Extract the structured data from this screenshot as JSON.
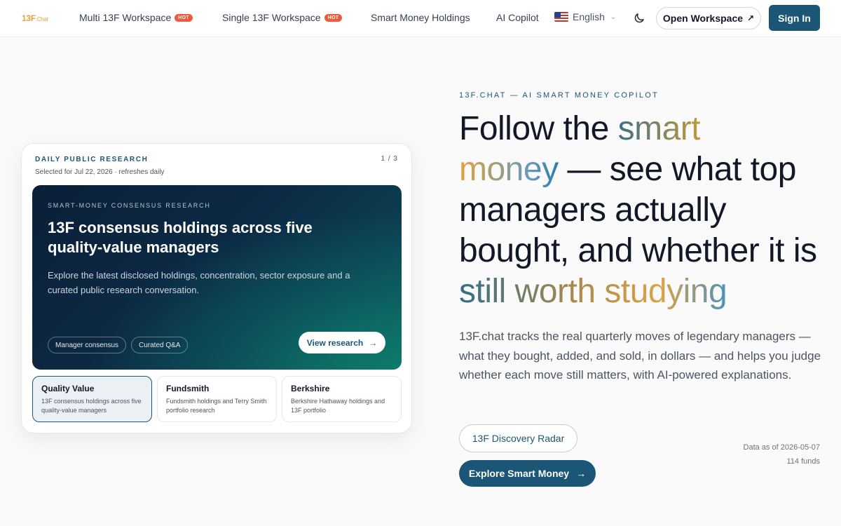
{
  "nav": {
    "logo": "13F",
    "logo_suffix": ".Chat",
    "links": [
      {
        "label": "Multi 13F Workspace",
        "badge": "HOT"
      },
      {
        "label": "Single 13F Workspace",
        "badge": "HOT"
      },
      {
        "label": "Smart Money Holdings"
      },
      {
        "label": "AI Copilot"
      }
    ],
    "language": "English",
    "open_workspace": "Open Workspace",
    "sign_in": "Sign In"
  },
  "card": {
    "eyebrow": "DAILY PUBLIC RESEARCH",
    "subtitle": "Selected for Jul 22, 2026 · refreshes daily",
    "counter": "1 / 3",
    "hero": {
      "eyebrow": "SMART-MONEY CONSENSUS RESEARCH",
      "title": "13F consensus holdings across five quality-value managers",
      "description": "Explore the latest disclosed holdings, concentration, sector exposure and a curated public research conversation.",
      "tags": [
        "Manager consensus",
        "Curated Q&A"
      ],
      "cta": "View research"
    },
    "tabs": [
      {
        "title": "Quality Value",
        "desc": "13F consensus holdings across five quality-value managers"
      },
      {
        "title": "Fundsmith",
        "desc": "Fundsmith holdings and Terry Smith portfolio research"
      },
      {
        "title": "Berkshire",
        "desc": "Berkshire Hathaway holdings and 13F portfolio"
      }
    ]
  },
  "main": {
    "eyebrow": "13F.CHAT — AI SMART MONEY COPILOT",
    "headline": {
      "p1": "Follow the ",
      "h1": "smart",
      "h2": "money",
      "p2": " — see what top managers actually bought, and whether it is ",
      "h3": "still worth studying"
    },
    "description": "13F.chat tracks the real quarterly moves of legendary managers — what they bought, added, and sold, in dollars — and helps you judge whether each move still matters, with AI-powered explanations.",
    "radar_button": "13F Discovery Radar",
    "explore_button": "Explore Smart Money",
    "data_as_of": "Data as of 2026-05-07",
    "funds_count": "114 funds"
  },
  "colors": {
    "brand": "#1b5676",
    "hot_badge": "#ef5a3c",
    "logo": "#e8a33a"
  }
}
